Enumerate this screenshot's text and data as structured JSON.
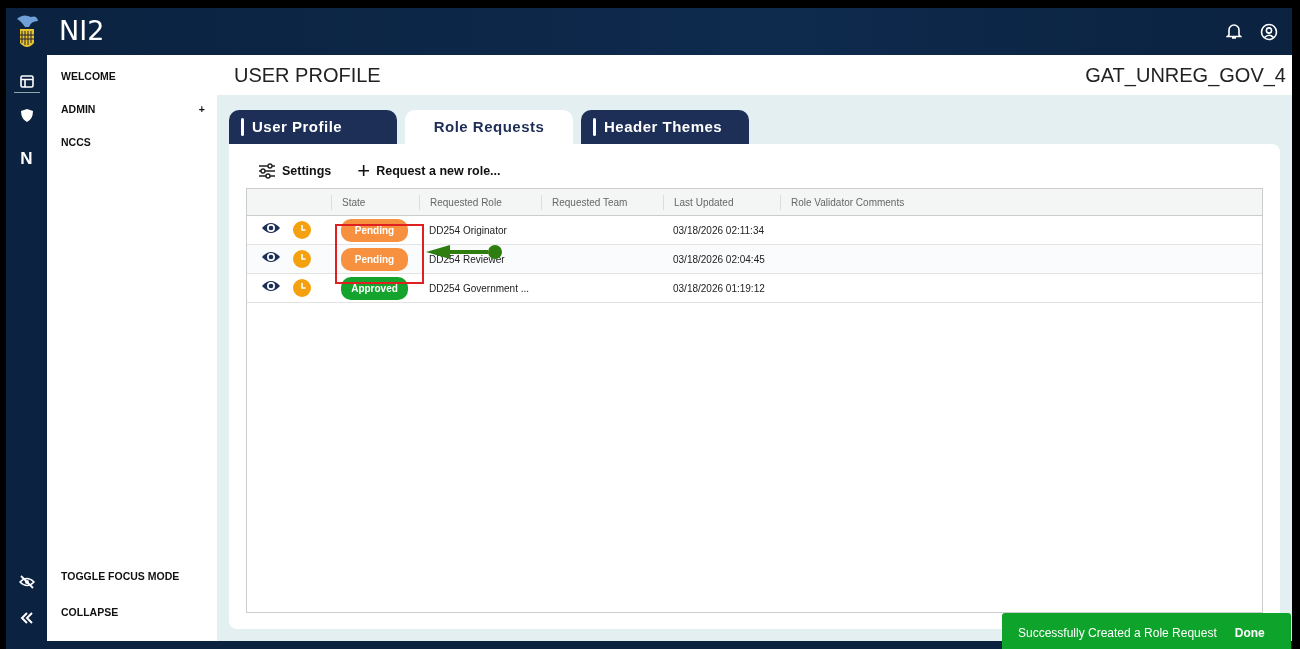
{
  "header": {
    "app_name": "NI2"
  },
  "sidebar": {
    "items": [
      {
        "label": "WELCOME"
      },
      {
        "label": "ADMIN",
        "expand_icon": "+"
      },
      {
        "label": "NCCS"
      }
    ],
    "footer_items": [
      {
        "label": "TOGGLE FOCUS MODE"
      },
      {
        "label": "COLLAPSE"
      }
    ],
    "rail_letter": "N"
  },
  "page": {
    "title": "USER PROFILE",
    "user": "GAT_UNREG_GOV_4"
  },
  "tabs": [
    {
      "label": "User Profile",
      "selected": false
    },
    {
      "label": "Role Requests",
      "selected": true
    },
    {
      "label": "Header Themes",
      "selected": false
    }
  ],
  "toolbar": {
    "settings": "Settings",
    "add_icon": "+",
    "request": "Request a new role..."
  },
  "table": {
    "columns": [
      "State",
      "Requested Role",
      "Requested Team",
      "Last Updated",
      "Role Validator Comments"
    ],
    "rows": [
      {
        "state": "Pending",
        "color": "#f7913f",
        "role": "DD254 Originator",
        "updated": "03/18/2026 02:11:34"
      },
      {
        "state": "Pending",
        "color": "#f7913f",
        "role": "DD254 Reviewer",
        "updated": "03/18/2026 02:04:45"
      },
      {
        "state": "Approved",
        "color": "#14a32d",
        "role": "DD254 Government ...",
        "updated": "03/18/2026 01:19:12"
      }
    ]
  },
  "toast": {
    "message": "Successfully Created a Role Request",
    "action": "Done"
  }
}
